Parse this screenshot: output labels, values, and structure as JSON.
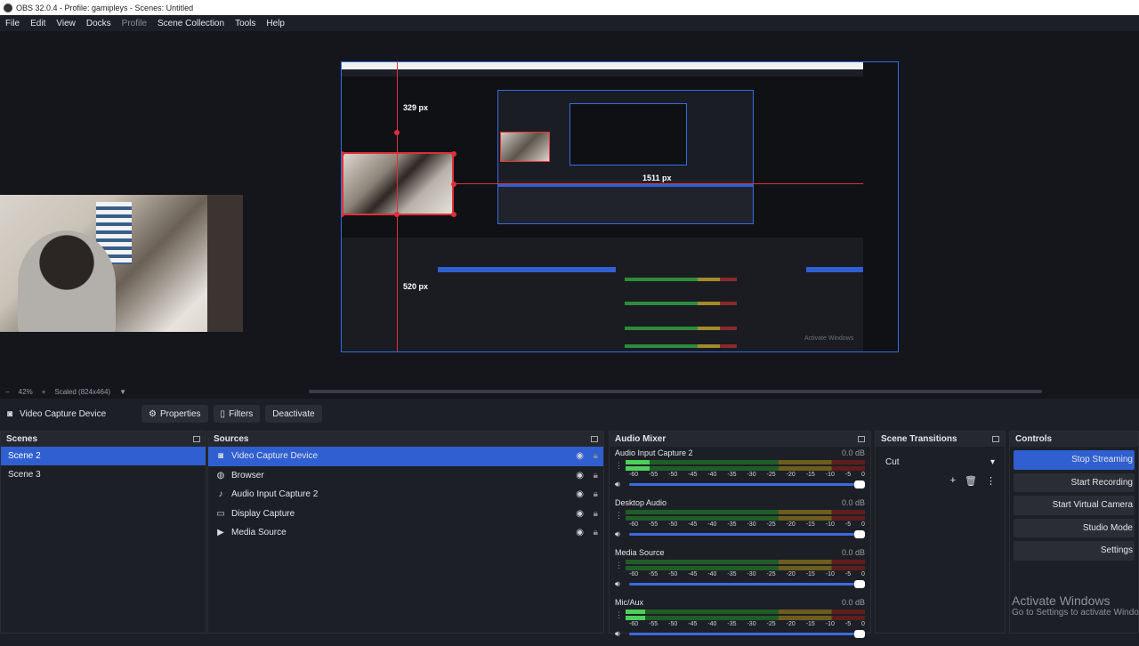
{
  "window": {
    "title": "OBS 32.0.4 - Profile: gamipleys - Scenes: Untitled"
  },
  "menu": [
    "File",
    "Edit",
    "View",
    "Docks",
    "Profile",
    "Scene Collection",
    "Tools",
    "Help"
  ],
  "preview": {
    "measure_top": "329 px",
    "measure_right": "1511 px",
    "measure_bottom": "520 px",
    "inner_watermark": "Activate Windows"
  },
  "status": {
    "zoom": "42%",
    "scale": "Scaled (824x464)"
  },
  "source_toolbar": {
    "source_name": "Video Capture Device",
    "properties": "Properties",
    "filters": "Filters",
    "deactivate": "Deactivate"
  },
  "scenes": {
    "title": "Scenes",
    "items": [
      "Scene 2",
      "Scene 3"
    ]
  },
  "sources": {
    "title": "Sources",
    "items": [
      {
        "name": "Video Capture Device",
        "icon": "camera-icon"
      },
      {
        "name": "Browser",
        "icon": "globe-icon"
      },
      {
        "name": "Audio Input Capture 2",
        "icon": "microphone-icon"
      },
      {
        "name": "Display Capture",
        "icon": "monitor-icon"
      },
      {
        "name": "Media Source",
        "icon": "play-icon"
      }
    ]
  },
  "mixer": {
    "title": "Audio Mixer",
    "scale": [
      "-60",
      "-55",
      "-50",
      "-45",
      "-40",
      "-35",
      "-30",
      "-25",
      "-20",
      "-15",
      "-10",
      "-5",
      "0"
    ],
    "channels": [
      {
        "name": "Audio Input Capture 2",
        "db": "0.0 dB",
        "level": 0.1
      },
      {
        "name": "Desktop Audio",
        "db": "0.0 dB",
        "level": 0
      },
      {
        "name": "Media Source",
        "db": "0.0 dB",
        "level": 0
      },
      {
        "name": "Mic/Aux",
        "db": "0.0 dB",
        "level": 0.08
      }
    ]
  },
  "transitions": {
    "title": "Scene Transitions",
    "selected": "Cut"
  },
  "controls": {
    "title": "Controls",
    "buttons": [
      "Stop Streaming",
      "Start Recording",
      "Start Virtual Camera",
      "Studio Mode",
      "Settings"
    ]
  },
  "watermark": {
    "title": "Activate Windows",
    "subtitle": "Go to Settings to activate Windows."
  },
  "colors": {
    "accent": "#2f5fd0",
    "bounding": "#e0303a",
    "background": "#1d1f26"
  }
}
